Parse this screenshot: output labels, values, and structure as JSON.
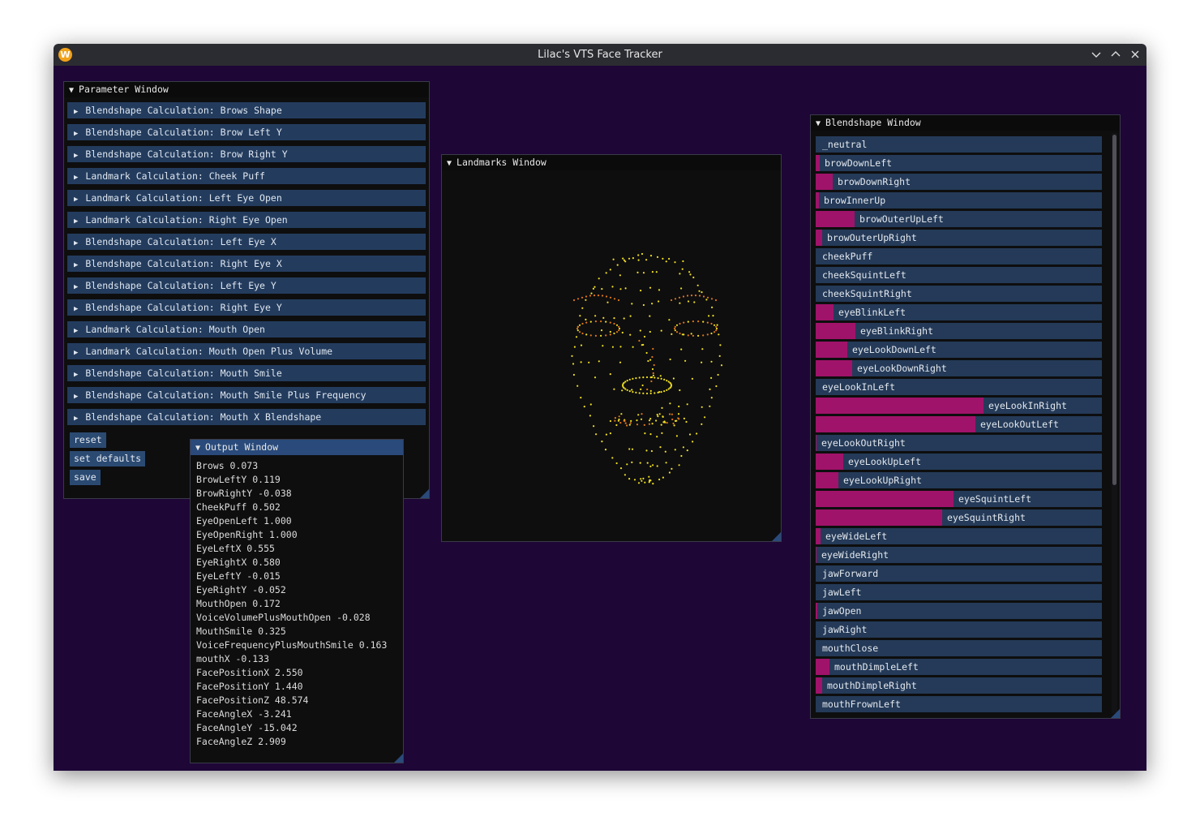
{
  "app": {
    "title": "Lilac's VTS Face Tracker",
    "icon_letter": "W",
    "controls": [
      "minimize-icon",
      "maximize-icon",
      "close-icon"
    ]
  },
  "parameter_window": {
    "title": "Parameter Window",
    "headers": [
      "Blendshape Calculation: Brows Shape",
      "Blendshape Calculation: Brow Left Y",
      "Blendshape Calculation: Brow Right Y",
      "Landmark Calculation: Cheek Puff",
      "Landmark Calculation: Left Eye Open",
      "Landmark Calculation: Right Eye Open",
      "Blendshape Calculation: Left Eye X",
      "Blendshape Calculation: Right Eye X",
      "Blendshape Calculation: Left Eye Y",
      "Blendshape Calculation: Right Eye Y",
      "Landmark Calculation: Mouth Open",
      "Landmark Calculation: Mouth Open Plus Volume",
      "Blendshape Calculation: Mouth Smile",
      "Blendshape Calculation: Mouth Smile Plus Frequency",
      "Blendshape Calculation: Mouth X Blendshape"
    ],
    "buttons": [
      "reset",
      "set defaults",
      "save"
    ]
  },
  "output_window": {
    "title": "Output Window",
    "lines": [
      "Brows 0.073",
      "BrowLeftY 0.119",
      "BrowRightY -0.038",
      "CheekPuff 0.502",
      "EyeOpenLeft 1.000",
      "EyeOpenRight 1.000",
      "EyeLeftX 0.555",
      "EyeRightX 0.580",
      "EyeLeftY -0.015",
      "EyeRightY -0.052",
      "MouthOpen 0.172",
      "VoiceVolumePlusMouthOpen -0.028",
      "MouthSmile 0.325",
      "VoiceFrequencyPlusMouthSmile 0.163",
      "mouthX -0.133",
      "FacePositionX 2.550",
      "FacePositionY 1.440",
      "FacePositionZ 48.574",
      "FaceAngleX -3.241",
      "FaceAngleY -15.042",
      "FaceAngleZ 2.909"
    ]
  },
  "landmarks_window": {
    "title": "Landmarks Window",
    "colors": {
      "point": "#f0e020",
      "highlight": "#e07818",
      "background": "#0e0e0f"
    }
  },
  "blendshape_window": {
    "title": "Blendshape Window",
    "fill_color": "#a0136a",
    "items": [
      {
        "name": "_neutral",
        "value": 0.0
      },
      {
        "name": "browDownLeft",
        "value": 0.015
      },
      {
        "name": "browDownRight",
        "value": 0.06
      },
      {
        "name": "browInnerUp",
        "value": 0.01
      },
      {
        "name": "browOuterUpLeft",
        "value": 0.137
      },
      {
        "name": "browOuterUpRight",
        "value": 0.022
      },
      {
        "name": "cheekPuff",
        "value": 0.0
      },
      {
        "name": "cheekSquintLeft",
        "value": 0.0
      },
      {
        "name": "cheekSquintRight",
        "value": 0.0
      },
      {
        "name": "eyeBlinkLeft",
        "value": 0.062
      },
      {
        "name": "eyeBlinkRight",
        "value": 0.14
      },
      {
        "name": "eyeLookDownLeft",
        "value": 0.111
      },
      {
        "name": "eyeLookDownRight",
        "value": 0.128
      },
      {
        "name": "eyeLookInLeft",
        "value": 0.0
      },
      {
        "name": "eyeLookInRight",
        "value": 0.586
      },
      {
        "name": "eyeLookOutLeft",
        "value": 0.558
      },
      {
        "name": "eyeLookOutRight",
        "value": 0.004
      },
      {
        "name": "eyeLookUpLeft",
        "value": 0.097
      },
      {
        "name": "eyeLookUpRight",
        "value": 0.078
      },
      {
        "name": "eyeSquintLeft",
        "value": 0.483
      },
      {
        "name": "eyeSquintRight",
        "value": 0.443
      },
      {
        "name": "eyeWideLeft",
        "value": 0.016
      },
      {
        "name": "eyeWideRight",
        "value": 0.004
      },
      {
        "name": "jawForward",
        "value": 0.0
      },
      {
        "name": "jawLeft",
        "value": 0.0
      },
      {
        "name": "jawOpen",
        "value": 0.007
      },
      {
        "name": "jawRight",
        "value": 0.0
      },
      {
        "name": "mouthClose",
        "value": 0.0
      },
      {
        "name": "mouthDimpleLeft",
        "value": 0.049
      },
      {
        "name": "mouthDimpleRight",
        "value": 0.024
      },
      {
        "name": "mouthFrownLeft",
        "value": 0.0
      }
    ]
  }
}
